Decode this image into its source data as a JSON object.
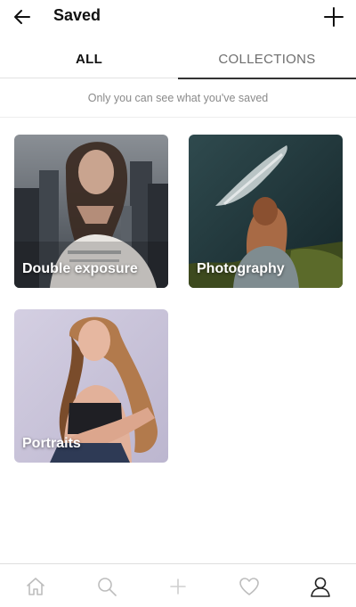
{
  "header": {
    "title": "Saved",
    "back_icon": "arrow-left-icon",
    "add_icon": "plus-icon"
  },
  "tabs": [
    {
      "label": "ALL",
      "active": false
    },
    {
      "label": "COLLECTIONS",
      "active": true
    }
  ],
  "notice": "Only you can see what you've saved",
  "collections": [
    {
      "label": "Double exposure",
      "image": "woman-city-double-exposure"
    },
    {
      "label": "Photography",
      "image": "woman-overlooking-coast"
    },
    {
      "label": "Portraits",
      "image": "woman-portrait"
    }
  ],
  "bottom_nav": [
    {
      "icon": "home-icon"
    },
    {
      "icon": "search-icon"
    },
    {
      "icon": "plus-icon"
    },
    {
      "icon": "heart-icon"
    },
    {
      "icon": "profile-icon",
      "active": true
    }
  ],
  "colors": {
    "active_text": "#111111",
    "inactive_text": "#6e6e6e",
    "muted_text": "#8a8a8a",
    "divider": "#e2e2e2",
    "nav_icon_inactive": "#bdbdbd",
    "nav_icon_active": "#222222"
  }
}
